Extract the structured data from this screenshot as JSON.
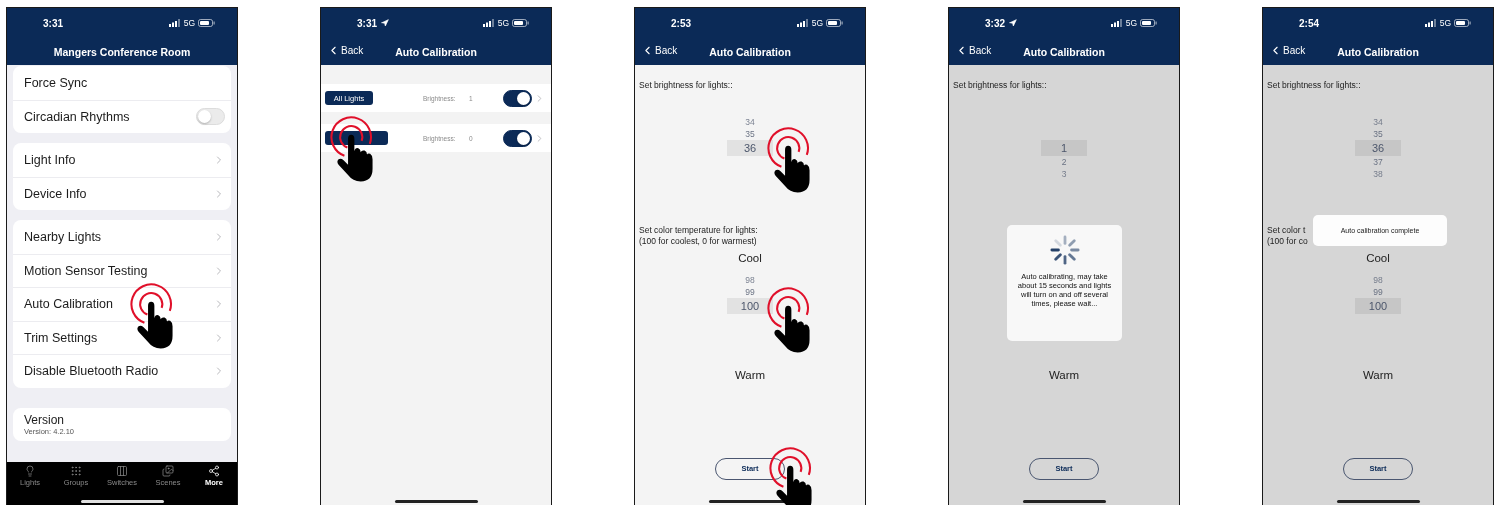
{
  "screens": [
    {
      "kind": "settings",
      "time": "3:31",
      "location": false,
      "network": "5G",
      "title": "Mangers Conference Room",
      "groups": [
        {
          "rows": [
            {
              "label": "Force Sync",
              "kind": "plain",
              "tap": false
            },
            {
              "label": "Circadian Rhythms",
              "kind": "toggle",
              "on": false,
              "tap": false
            }
          ]
        },
        {
          "rows": [
            {
              "label": "Light Info",
              "kind": "link",
              "tap": false
            },
            {
              "label": "Device Info",
              "kind": "link",
              "tap": false
            }
          ]
        },
        {
          "rows": [
            {
              "label": "Nearby Lights",
              "kind": "link",
              "tap": false
            },
            {
              "label": "Motion Sensor Testing",
              "kind": "link",
              "tap": false
            },
            {
              "label": "Auto Calibration",
              "kind": "link",
              "tap": true
            },
            {
              "label": "Trim Settings",
              "kind": "link",
              "tap": false
            },
            {
              "label": "Disable Bluetooth Radio",
              "kind": "link",
              "tap": false
            }
          ]
        }
      ],
      "version": {
        "label": "Version",
        "value": "Version: 4.2.10"
      },
      "tabs": [
        {
          "label": "Lights",
          "selected": false
        },
        {
          "label": "Groups",
          "selected": false
        },
        {
          "label": "Switches",
          "selected": false
        },
        {
          "label": "Scenes",
          "selected": false
        },
        {
          "label": "More",
          "selected": true
        }
      ]
    },
    {
      "kind": "light_list",
      "time": "3:31",
      "location": true,
      "network": "5G",
      "back": "Back",
      "title": "Auto Calibration",
      "rows": [
        {
          "button": "All Lights",
          "brightness_label": "Brightness:",
          "brightness": "1",
          "on": true,
          "tap": false
        },
        {
          "brightness_label": "Brightness:",
          "brightness": "0",
          "on": true,
          "tap": true
        }
      ]
    },
    {
      "kind": "calibration",
      "time": "2:53",
      "location": false,
      "network": "5G",
      "back": "Back",
      "title": "Auto Calibration",
      "dimmed": false,
      "brightness_label": "Set brightness for lights::",
      "brightness_picker": {
        "tap": true,
        "items": [
          {
            "label": "34",
            "selected": false
          },
          {
            "label": "35",
            "selected": false
          },
          {
            "label": "36",
            "selected": true
          }
        ]
      },
      "temperature_label": [
        "Set color temperature for lights:",
        "(100 for coolest, 0 for warmest)"
      ],
      "cool": "Cool",
      "temperature_picker": {
        "tap": true,
        "items": [
          {
            "label": "98",
            "selected": false
          },
          {
            "label": "99",
            "selected": false
          },
          {
            "label": "100",
            "selected": true
          }
        ]
      },
      "warm": "Warm",
      "start": {
        "label": "Start",
        "tap": true
      }
    },
    {
      "kind": "calibration",
      "time": "3:32",
      "location": true,
      "network": "5G",
      "back": "Back",
      "title": "Auto Calibration",
      "dimmed": true,
      "brightness_label": "Set brightness for lights::",
      "brightness_picker": {
        "tap": false,
        "items": [
          {
            "label": "1",
            "selected": true
          },
          {
            "label": "2",
            "selected": false
          },
          {
            "label": "3",
            "selected": false
          }
        ]
      },
      "warm": "Warm",
      "start": {
        "label": "Start",
        "tap": false
      },
      "overlay": {
        "kind": "spinner",
        "text": "Auto calibrating, may take about 15 seconds and lights will turn on and off several times, please wait..."
      }
    },
    {
      "kind": "calibration",
      "time": "2:54",
      "location": false,
      "network": "5G",
      "back": "Back",
      "title": "Auto Calibration",
      "dimmed": true,
      "brightness_label": "Set brightness for lights::",
      "brightness_picker": {
        "tap": false,
        "items": [
          {
            "label": "34",
            "selected": false
          },
          {
            "label": "35",
            "selected": false
          },
          {
            "label": "36",
            "selected": true
          },
          {
            "label": "37",
            "selected": false
          },
          {
            "label": "38",
            "selected": false
          }
        ]
      },
      "temperature_label": [
        "Set color t",
        "(100 for co"
      ],
      "cool": "Cool",
      "temperature_picker": {
        "tap": false,
        "items": [
          {
            "label": "98",
            "selected": false
          },
          {
            "label": "99",
            "selected": false
          },
          {
            "label": "100",
            "selected": true
          }
        ]
      },
      "warm": "Warm",
      "start": {
        "label": "Start",
        "tap": false
      },
      "overlay": {
        "kind": "toast",
        "text": "Auto calibration complete"
      }
    }
  ]
}
